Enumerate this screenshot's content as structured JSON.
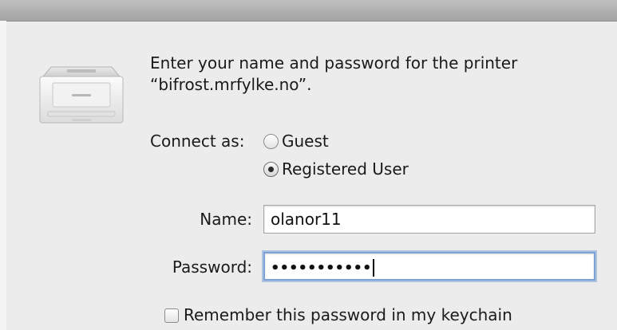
{
  "dialog": {
    "message_line1": "Enter your name and password for the printer",
    "message_line2": "“bifrost.mrfylke.no”."
  },
  "connect": {
    "label": "Connect as:",
    "options": [
      {
        "label": "Guest",
        "selected": false
      },
      {
        "label": "Registered User",
        "selected": true
      }
    ]
  },
  "fields": {
    "name": {
      "label": "Name:",
      "value": "olanor11"
    },
    "password": {
      "label": "Password:",
      "masked_value": "•••••••••••"
    }
  },
  "remember": {
    "label": "Remember this password in my keychain",
    "checked": false
  },
  "icons": {
    "printer": "printer-icon"
  }
}
